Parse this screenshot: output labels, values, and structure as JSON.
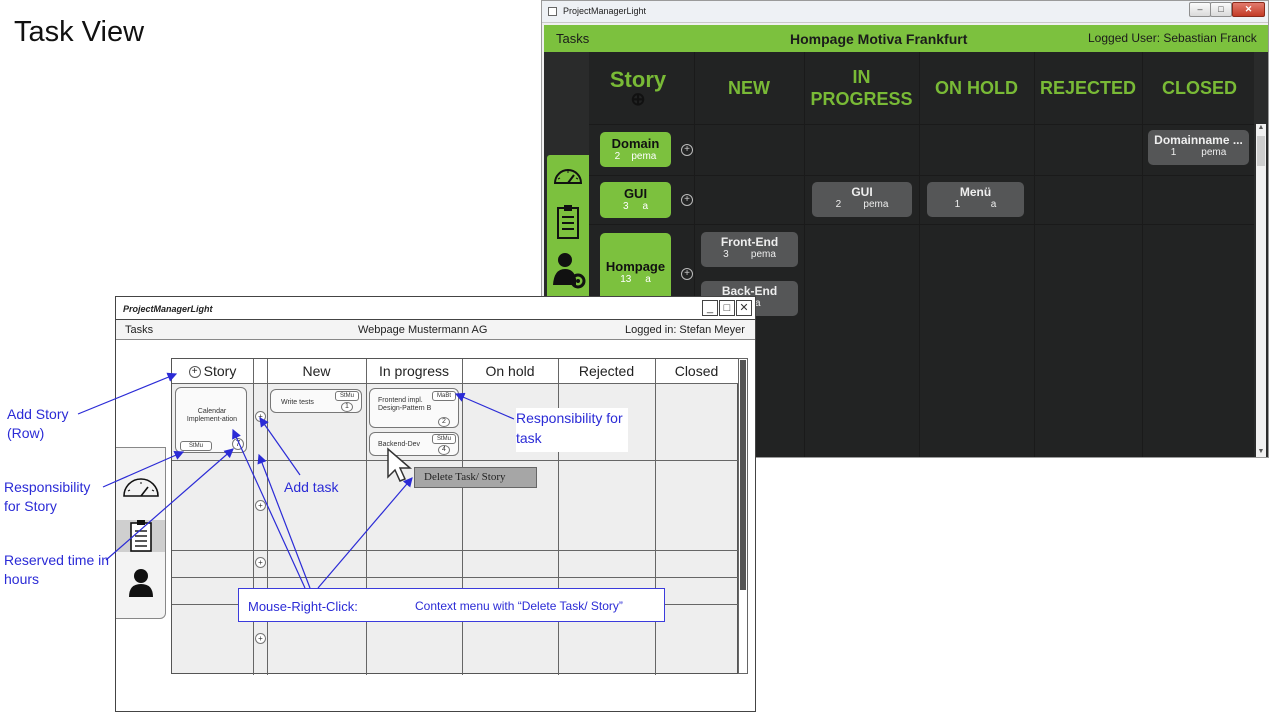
{
  "slide": {
    "title": "Task View"
  },
  "app": {
    "window_title": "ProjectManagerLight",
    "window_buttons": {
      "minimize": "–",
      "maximize": "□",
      "close": "✕"
    },
    "menu": {
      "tasks": "Tasks",
      "project": "Hompage Motiva Frankfurt",
      "user": "Logged User: Sebastian Franck"
    },
    "columns": {
      "story": "Story",
      "add_story": "⊕",
      "new": "NEW",
      "in_progress": "IN PROGRESS",
      "on_hold": "ON HOLD",
      "rejected": "REJECTED",
      "closed": "CLOSED"
    },
    "sidebar": {
      "icons": [
        "dashboard-icon",
        "clipboard-icon",
        "user-settings-icon"
      ]
    },
    "stories": [
      {
        "name": "Domain",
        "hours": "2",
        "owner": "pema"
      },
      {
        "name": "GUI",
        "hours": "3",
        "owner": "a"
      },
      {
        "name": "Hompage",
        "hours": "13",
        "owner": "a"
      }
    ],
    "add_task": "+",
    "tasks": [
      {
        "name": "Domainname ...",
        "hours": "1",
        "owner": "pema",
        "column": "CLOSED",
        "story": "Domain"
      },
      {
        "name": "GUI",
        "hours": "2",
        "owner": "pema",
        "column": "IN PROGRESS",
        "story": "GUI"
      },
      {
        "name": "Menü",
        "hours": "1",
        "owner": "a",
        "column": "ON HOLD",
        "story": "GUI"
      },
      {
        "name": "Front-End",
        "hours": "3",
        "owner": "pema",
        "column": "NEW",
        "story": "Hompage"
      },
      {
        "name": "Back-End",
        "hours": "",
        "owner": "a",
        "column": "NEW",
        "story": "Hompage"
      }
    ],
    "scroll": {
      "up": "▲",
      "down": "▼"
    }
  },
  "mockup": {
    "window_title": "ProjectManagerLight",
    "window_buttons": {
      "minimize": "_",
      "maximize": "□",
      "close": "✕"
    },
    "menu": {
      "tasks": "Tasks",
      "project": "Webpage Mustermann AG",
      "user": "Logged in: Stefan Meyer"
    },
    "columns": {
      "story": "Story",
      "add_story": "+",
      "new": "New",
      "in_progress": "In progress",
      "on_hold": "On hold",
      "rejected": "Rejected",
      "closed": "Closed"
    },
    "story_card": {
      "name": "Calendar Implement-ation",
      "owner": "StMu",
      "hours": "7"
    },
    "add_task": "+",
    "tasks": [
      {
        "name": "Write tests",
        "owner": "StMu",
        "hours": "1"
      },
      {
        "name": "Frontend impl. Design-Pattern B",
        "owner": "MaBt",
        "hours": "2"
      },
      {
        "name": "Backend-Dev",
        "owner": "StMu",
        "hours": "4"
      }
    ],
    "context_menu": "Delete Task/ Story",
    "callout": {
      "action": "Mouse-Right-Click:",
      "description": "Context menu with “Delete Task/ Story”"
    },
    "responsibility_task": "Responsibility for task"
  },
  "annotations": {
    "add_story": "Add Story (Row)",
    "add_task": "Add task",
    "responsibility_story": "Responsibility for Story",
    "reserved_time": "Reserved time in hours"
  },
  "colors": {
    "app_green": "#7cc13e",
    "board_dark": "#222323",
    "annotation_blue": "#2b2bd6",
    "mock_grid": "#eeeeee"
  }
}
